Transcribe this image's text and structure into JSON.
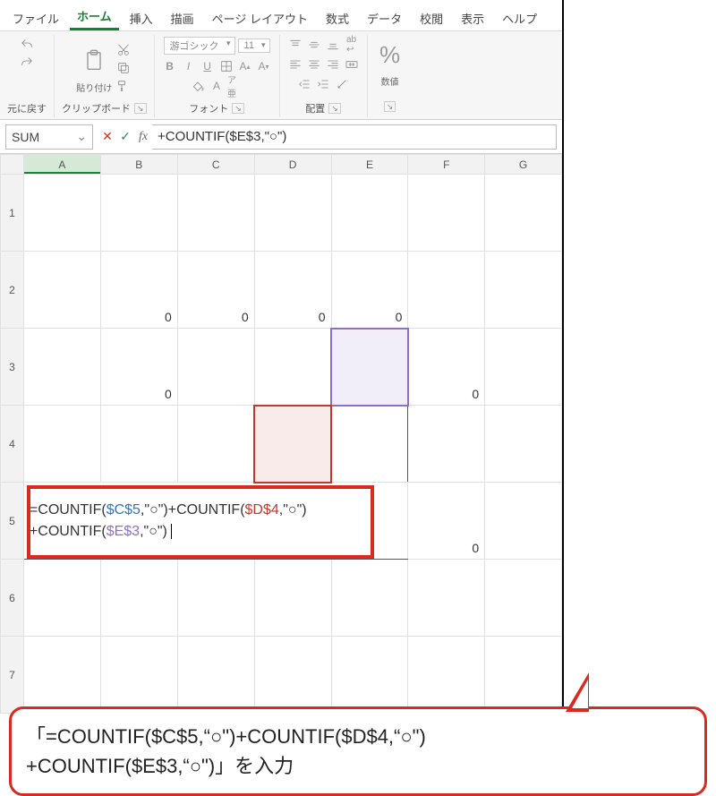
{
  "menu": {
    "items": [
      "ファイル",
      "ホーム",
      "挿入",
      "描画",
      "ページ レイアウト",
      "数式",
      "データ",
      "校閲",
      "表示",
      "ヘルプ"
    ],
    "active": 1
  },
  "ribbon": {
    "undo": {
      "label": "元に戻す"
    },
    "clipboard": {
      "label": "クリップボード",
      "paste": "貼り付け"
    },
    "font": {
      "label": "フォント",
      "name": "游ゴシック",
      "size": "11"
    },
    "align": {
      "label": "配置"
    },
    "number": {
      "label": "数値"
    }
  },
  "formula_bar": {
    "name_box": "SUM",
    "formula": "+COUNTIF($E$3,\"○\")"
  },
  "columns": [
    "A",
    "B",
    "C",
    "D",
    "E",
    "F",
    "G"
  ],
  "rows": [
    "1",
    "2",
    "3",
    "4",
    "5",
    "6",
    "7"
  ],
  "cells": {
    "B2": "0",
    "C2": "0",
    "D2": "0",
    "E2": "0",
    "B3": "0",
    "F3": "0",
    "F5": "0"
  },
  "editing_cell": {
    "prefix": "=COUNTIF(",
    "ref1": "$C$5",
    "mid1": ",\"○\")+COUNTIF(",
    "ref2": "$D$4",
    "mid2": ",\"○\")",
    "line2a": "+COUNTIF(",
    "ref3": "$E$3",
    "tail": ",\"○\")"
  },
  "callout": {
    "text_line1": "「=COUNTIF($C$5,“○\")+COUNTIF($D$4,“○\")",
    "text_line2": "+COUNTIF($E$3,“○\")」を入力"
  }
}
